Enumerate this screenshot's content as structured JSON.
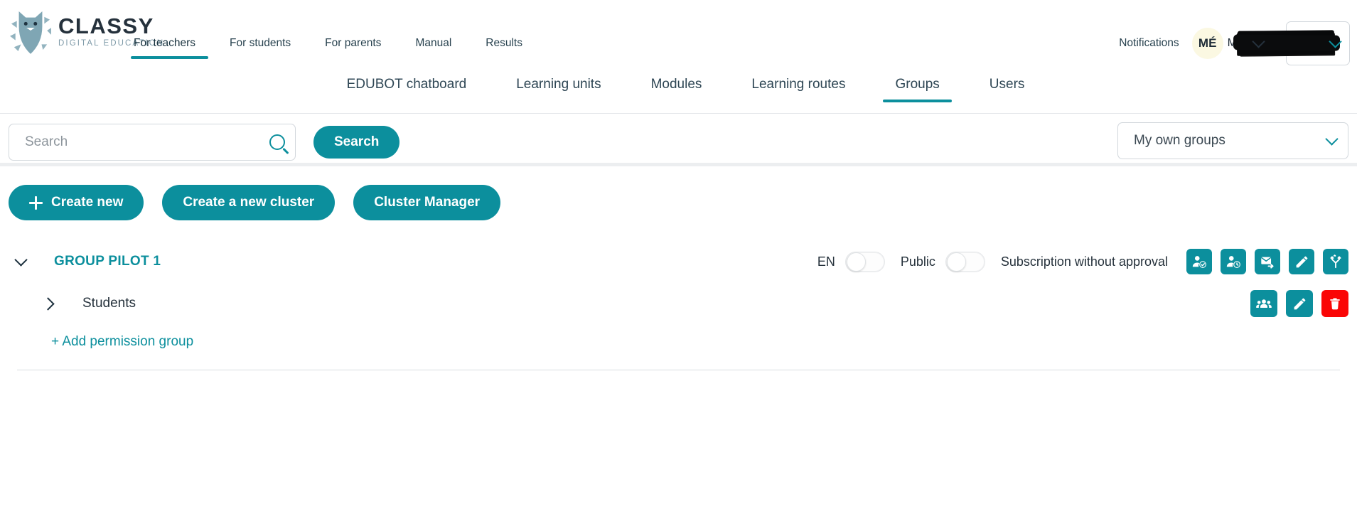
{
  "brand": {
    "name": "CLASSY",
    "tagline": "DIGITAL EDUCATION",
    "logo_icon": "fox-head-logo",
    "accent_color": "#0c8f9d",
    "danger_color": "#fa0606"
  },
  "header": {
    "primary_nav": [
      {
        "label": "For teachers",
        "active": true
      },
      {
        "label": "For students",
        "active": false
      },
      {
        "label": "For parents",
        "active": false
      },
      {
        "label": "Manual",
        "active": false
      },
      {
        "label": "Results",
        "active": false
      }
    ],
    "notifications_label": "Notifications",
    "avatar_initials": "MÉ",
    "username": "M",
    "username_redacted": true,
    "user_chevron_icon": "chevron-down-icon",
    "language": {
      "selected": "EN",
      "chevron_icon": "chevron-down-icon"
    }
  },
  "secondary_nav": [
    {
      "label": "EDUBOT chatboard",
      "active": false
    },
    {
      "label": "Learning units",
      "active": false
    },
    {
      "label": "Modules",
      "active": false
    },
    {
      "label": "Learning routes",
      "active": false
    },
    {
      "label": "Groups",
      "active": true
    },
    {
      "label": "Users",
      "active": false
    }
  ],
  "search": {
    "value": "",
    "placeholder": "Search",
    "icon": "magnifier-icon",
    "button_label": "Search"
  },
  "groups_filter": {
    "selected": "My own groups",
    "chevron_icon": "chevron-down-icon"
  },
  "actions": [
    {
      "label": "Create new",
      "icon": "plus-icon"
    },
    {
      "label": "Create a new cluster",
      "icon": null
    },
    {
      "label": "Cluster Manager",
      "icon": null
    }
  ],
  "group": {
    "caret_icon": "chevron-down-icon",
    "title": "GROUP PILOT 1",
    "language_label": "EN",
    "language_toggle_on": false,
    "public_label": "Public",
    "public_toggle_on": false,
    "subscription_label": "Subscription without approval",
    "icons": [
      {
        "name": "approve-member-icon"
      },
      {
        "name": "pending-member-icon"
      },
      {
        "name": "send-invite-email-icon"
      },
      {
        "name": "edit-group-icon"
      },
      {
        "name": "group-branch-icon"
      }
    ],
    "children": [
      {
        "caret_icon": "chevron-right-icon",
        "label": "Students",
        "icons": [
          {
            "name": "members-icon"
          },
          {
            "name": "edit-icon"
          },
          {
            "name": "delete-icon"
          }
        ]
      }
    ],
    "add_permission_label": "+ Add permission group"
  }
}
